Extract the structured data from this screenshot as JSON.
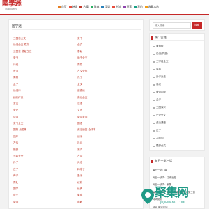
{
  "site": {
    "logo": "國學迷",
    "logo_sub": "guoxuemi"
  },
  "nav": [
    {
      "label": "首页",
      "icon": "home-icon",
      "color": "#e67e22"
    },
    {
      "label": "诗词",
      "icon": "poem-icon",
      "color": "#e74c3c"
    },
    {
      "label": "古籍",
      "icon": "book-icon",
      "color": "#c0392b"
    },
    {
      "label": "辞典",
      "icon": "dictionary-icon",
      "color": "#27ae60"
    },
    {
      "label": "汉语",
      "icon": "hanzi-icon",
      "color": "#2980b9"
    },
    {
      "label": "书法",
      "icon": "brush-icon",
      "color": "#e74c3c"
    },
    {
      "label": "百家",
      "icon": "scholar-icon",
      "color": "#8e44ad"
    },
    {
      "label": "我的",
      "icon": "user-icon",
      "color": "#16a085"
    },
    {
      "label": "收藏本站",
      "icon": "star-icon",
      "color": "#f39c12"
    }
  ],
  "main": {
    "title": "国学迷",
    "grid": [
      [
        "三国志全文",
        "史书"
      ],
      [
        "论语全文 原文",
        "全文"
      ],
      [
        "三国志 裴松之注",
        "春秋"
      ],
      [
        "史书",
        "尚书全文"
      ],
      [
        "诗经",
        "周易"
      ],
      [
        "资治",
        "古文全集"
      ],
      [
        "周易",
        "孔子"
      ],
      [
        "孟子",
        "全文"
      ],
      [
        "论语诗",
        "道德经"
      ],
      [
        "纪传体史",
        "史记全文"
      ],
      [
        "古文",
        "汉语"
      ],
      [
        "史记",
        "文言"
      ],
      [
        "诗词",
        "唐诗宋词"
      ],
      [
        "史书全文",
        "国语"
      ],
      [
        "国策 战国策",
        "资治通鉴 全译本"
      ],
      [
        "四库",
        "诸子"
      ],
      [
        "左传",
        "礼记"
      ],
      [
        "楚辞",
        "宋词"
      ],
      [
        "元曲大全",
        "古诗"
      ],
      [
        "孙子",
        "兵法"
      ],
      [
        "庄子",
        "韩非子"
      ],
      [
        "荀子",
        "墨子"
      ],
      [
        "周礼",
        "仪礼"
      ],
      [
        "国学",
        "经典"
      ],
      [
        "说文",
        "集成"
      ],
      [
        "唐诗",
        "典籍"
      ]
    ]
  },
  "search": {
    "placeholder": "输入搜索",
    "button": "搜索"
  },
  "hot": {
    "title": "热门古籍",
    "items": [
      "道德经",
      "论语(节选)",
      "三字经全文",
      "周易",
      "孙子兵法",
      "诗经",
      "黄帝内经",
      "孟子",
      "三国演义",
      "史记全文",
      "资治通鉴",
      "庄子",
      "人间词",
      "楚辞全文"
    ]
  },
  "experience": {
    "title": "每日一学一读",
    "items": [
      "每日一学：春",
      "每日一读词：江南出处",
      "每日一读词：秋蕃",
      "每日一读词：春秋何处能参曹操诗第二首",
      "诗词赏析",
      "诗词 唐诗宋词"
    ]
  },
  "watermark": {
    "text": "聚集网",
    "url": "JUJIEWANG.COM"
  }
}
